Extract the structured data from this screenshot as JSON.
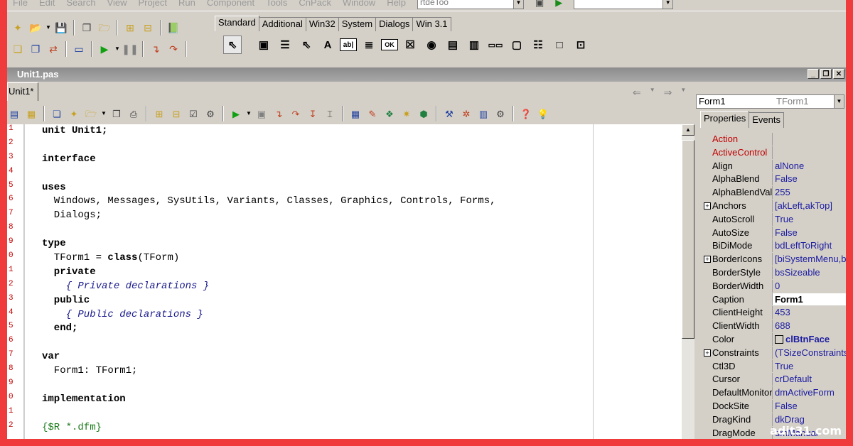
{
  "menu": {
    "items": [
      "File",
      "Edit",
      "Search",
      "View",
      "Project",
      "Run",
      "Component",
      "Tools",
      "CnPack",
      "Window",
      "Help"
    ],
    "combo1": "rtdeToo",
    "combo2": ""
  },
  "palette": {
    "tabs": [
      "Standard",
      "Additional",
      "Win32",
      "System",
      "Dialogs",
      "Win 3.1"
    ],
    "active_tab": "Standard"
  },
  "unit_window": {
    "title": "Unit1.pas",
    "editor_tab": "Unit1*"
  },
  "editor": {
    "line_numbers": [
      "1",
      "2",
      "3",
      "4",
      "5",
      "6",
      "7",
      "8",
      "9",
      "0",
      "1",
      "2",
      "3",
      "4",
      "5",
      "6",
      "7",
      "8",
      "9",
      "0",
      "1",
      "2"
    ],
    "lines": [
      {
        "t": "unit Unit1;",
        "s": "kw"
      },
      {
        "t": "",
        "s": ""
      },
      {
        "t": "interface",
        "s": "kw"
      },
      {
        "t": "",
        "s": ""
      },
      {
        "t": "uses",
        "s": "kw"
      },
      {
        "t": "  Windows, Messages, SysUtils, Variants, Classes, Graphics, Controls, Forms,",
        "s": ""
      },
      {
        "t": "  Dialogs;",
        "s": ""
      },
      {
        "t": "",
        "s": ""
      },
      {
        "t": "type",
        "s": "kw"
      },
      {
        "t": "  TForm1 = class(TForm)",
        "s": "mix"
      },
      {
        "t": "  private",
        "s": "kw"
      },
      {
        "t": "    { Private declarations }",
        "s": "cmt"
      },
      {
        "t": "  public",
        "s": "kw"
      },
      {
        "t": "    { Public declarations }",
        "s": "cmt"
      },
      {
        "t": "  end;",
        "s": "kw"
      },
      {
        "t": "",
        "s": ""
      },
      {
        "t": "var",
        "s": "kw"
      },
      {
        "t": "  Form1: TForm1;",
        "s": ""
      },
      {
        "t": "",
        "s": ""
      },
      {
        "t": "implementation",
        "s": "kw"
      },
      {
        "t": "",
        "s": ""
      },
      {
        "t": "{$R *.dfm}",
        "s": "dir"
      }
    ]
  },
  "inspector": {
    "object": "Form1",
    "class": "TForm1",
    "tabs": [
      "Properties",
      "Events"
    ],
    "active_tab": "Properties",
    "properties": [
      {
        "name": "Action",
        "value": "",
        "red": true
      },
      {
        "name": "ActiveControl",
        "value": "",
        "red": true
      },
      {
        "name": "Align",
        "value": "alNone"
      },
      {
        "name": "AlphaBlend",
        "value": "False"
      },
      {
        "name": "AlphaBlendValu",
        "value": "255"
      },
      {
        "name": "Anchors",
        "value": "[akLeft,akTop]",
        "expand": true
      },
      {
        "name": "AutoScroll",
        "value": "True"
      },
      {
        "name": "AutoSize",
        "value": "False"
      },
      {
        "name": "BiDiMode",
        "value": "bdLeftToRight"
      },
      {
        "name": "BorderIcons",
        "value": "[biSystemMenu,bi",
        "expand": true
      },
      {
        "name": "BorderStyle",
        "value": "bsSizeable"
      },
      {
        "name": "BorderWidth",
        "value": "0"
      },
      {
        "name": "Caption",
        "value": "Form1",
        "selected": true
      },
      {
        "name": "ClientHeight",
        "value": "453"
      },
      {
        "name": "ClientWidth",
        "value": "688"
      },
      {
        "name": "Color",
        "value": "clBtnFace",
        "swatch": true
      },
      {
        "name": "Constraints",
        "value": "(TSizeConstraints)",
        "expand": true
      },
      {
        "name": "Ctl3D",
        "value": "True"
      },
      {
        "name": "Cursor",
        "value": "crDefault"
      },
      {
        "name": "DefaultMonitor",
        "value": "dmActiveForm"
      },
      {
        "name": "DockSite",
        "value": "False"
      },
      {
        "name": "DragKind",
        "value": "dkDrag"
      },
      {
        "name": "DragMode",
        "value": "dmManual"
      }
    ]
  },
  "watermark": "adit31.com"
}
